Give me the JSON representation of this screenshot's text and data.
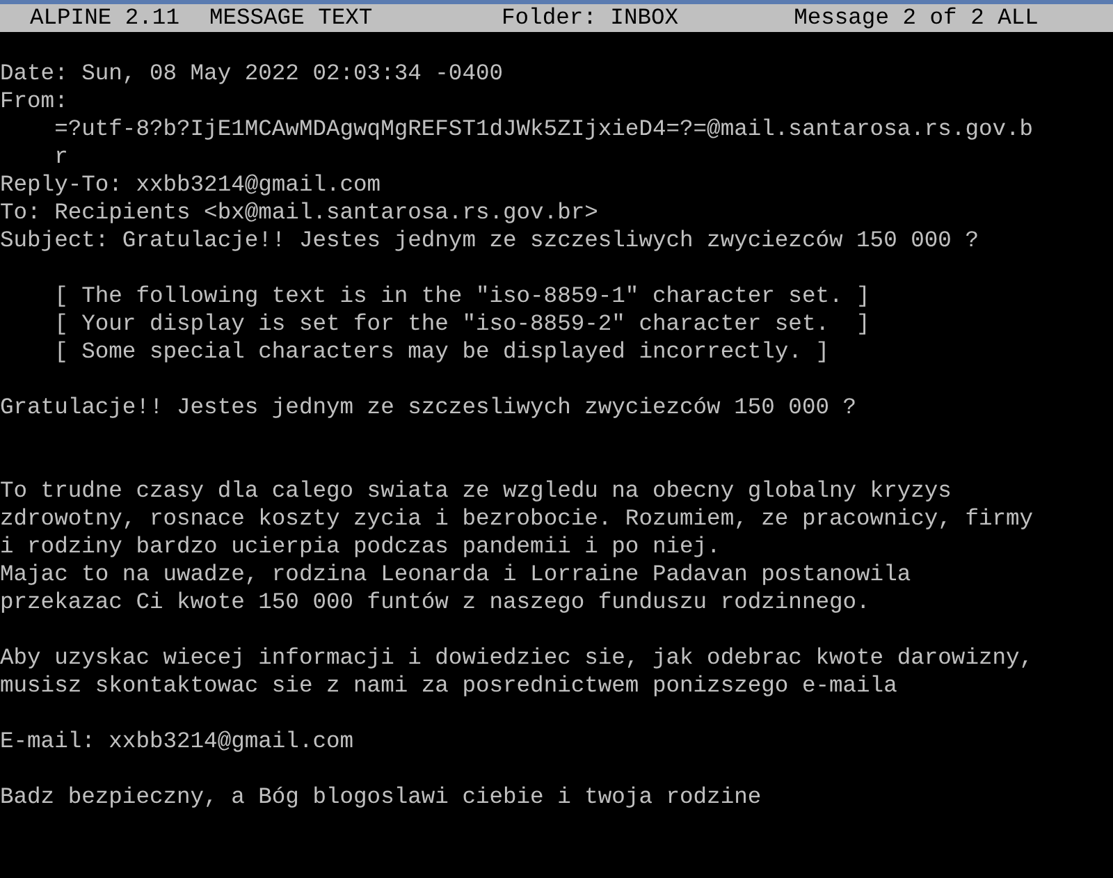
{
  "title_bar": [
    "ALPINE 2.11",
    "MESSAGE TEXT",
    "Folder: INBOX",
    "Message 2 of 2 ALL"
  ],
  "lines": [
    {
      "kind": "blank"
    },
    {
      "kind": "plain",
      "text": "Date: Sun, 08 May 2022 02:03:34 -0400"
    },
    {
      "kind": "plain",
      "text": "From:"
    },
    {
      "kind": "indented",
      "text": "=?utf-8?b?IjE1MCAwMDAgwqMgREFST1dJWk5ZIjxieD4=?=@mail.santarosa.rs.gov.b"
    },
    {
      "kind": "indented",
      "text": "r"
    },
    {
      "kind": "plain",
      "text": "Reply-To: xxbb3214@gmail.com"
    },
    {
      "kind": "plain",
      "text": "To: Recipients <bx@mail.santarosa.rs.gov.br>"
    },
    {
      "kind": "plain",
      "text": "Subject: Gratulacje!! Jestes jednym ze szczesliwych zwyciezców 150 000 ?"
    },
    {
      "kind": "blank"
    },
    {
      "kind": "indented",
      "text": "[ The following text is in the \"iso-8859-1\" character set. ]"
    },
    {
      "kind": "indented",
      "text": "[ Your display is set for the \"iso-8859-2\" character set.  ]"
    },
    {
      "kind": "indented",
      "text": "[ Some special characters may be displayed incorrectly. ]"
    },
    {
      "kind": "blank"
    },
    {
      "kind": "plain",
      "text": "Gratulacje!! Jestes jednym ze szczesliwych zwyciezców 150 000 ?"
    },
    {
      "kind": "blank"
    },
    {
      "kind": "blank"
    },
    {
      "kind": "plain",
      "text": "To trudne czasy dla calego swiata ze wzgledu na obecny globalny kryzys"
    },
    {
      "kind": "plain",
      "text": "zdrowotny, rosnace koszty zycia i bezrobocie. Rozumiem, ze pracownicy, firmy"
    },
    {
      "kind": "plain",
      "text": "i rodziny bardzo ucierpia podczas pandemii i po niej."
    },
    {
      "kind": "plain",
      "text": "Majac to na uwadze, rodzina Leonarda i Lorraine Padavan postanowila"
    },
    {
      "kind": "plain",
      "text": "przekazac Ci kwote 150 000 funtów z naszego funduszu rodzinnego."
    },
    {
      "kind": "blank"
    },
    {
      "kind": "plain",
      "text": "Aby uzyskac wiecej informacji i dowiedziec sie, jak odebrac kwote darowizny,"
    },
    {
      "kind": "plain",
      "text": "musisz skontaktowac sie z nami za posrednictwem ponizszego e-maila"
    },
    {
      "kind": "blank"
    },
    {
      "kind": "plain",
      "text": "E-mail: xxbb3214@gmail.com"
    },
    {
      "kind": "blank"
    },
    {
      "kind": "plain",
      "text": "Badz bezpieczny, a Bóg blogoslawi ciebie i twoja rodzine"
    }
  ]
}
